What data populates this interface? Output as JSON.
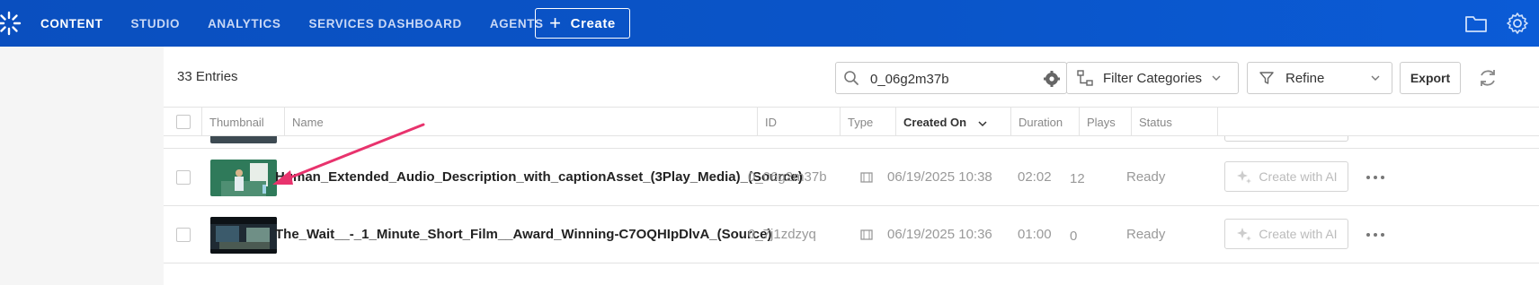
{
  "nav": {
    "items": [
      {
        "label": "CONTENT",
        "active": true
      },
      {
        "label": "STUDIO",
        "active": false
      },
      {
        "label": "ANALYTICS",
        "active": false
      },
      {
        "label": "SERVICES DASHBOARD",
        "active": false
      },
      {
        "label": "AGENTS",
        "active": false
      }
    ],
    "create_label": "Create",
    "icons": [
      "folder-icon",
      "gear-icon"
    ]
  },
  "toolbar": {
    "entries_count": "33 Entries",
    "search_value": "0_06g2m37b",
    "filter_categories_label": "Filter Categories",
    "refine_label": "Refine",
    "export_label": "Export"
  },
  "table": {
    "headers": {
      "thumbnail": "Thumbnail",
      "name": "Name",
      "id": "ID",
      "type": "Type",
      "created_on": "Created On",
      "duration": "Duration",
      "plays": "Plays",
      "status": "Status"
    },
    "rows": [
      {
        "name": "Human_Extended_Audio_Description_with_captionAsset_(3Play_Media)_(Source)",
        "id": "0_06g2m37b",
        "type_icon": "video-icon",
        "created_on": "06/19/2025 10:38",
        "duration": "02:02",
        "plays": "12",
        "status": "Ready",
        "action_label": "Create with AI"
      },
      {
        "name": "The_Wait__-_1_Minute_Short_Film__Award_Winning-C7OQHIpDlvA_(Source)",
        "id": "0_7j1zdzyq",
        "type_icon": "video-icon",
        "created_on": "06/19/2025 10:36",
        "duration": "01:00",
        "plays": "0",
        "status": "Ready",
        "action_label": "Create with AI"
      }
    ]
  },
  "colors": {
    "nav_bg": "#0a4fbf",
    "annotation_arrow": "#e8336d"
  }
}
